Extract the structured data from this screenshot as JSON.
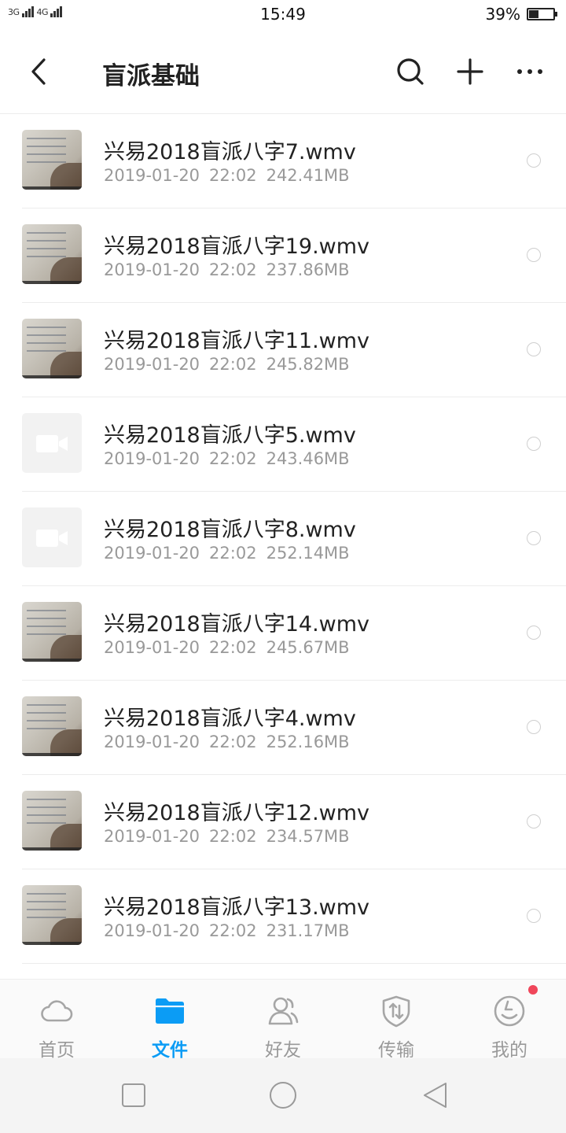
{
  "status_bar": {
    "network_1": "3G",
    "network_2": "4G",
    "time": "15:49",
    "battery_percent": "39%",
    "battery_level": 0.39
  },
  "header": {
    "title": "盲派基础",
    "icons": [
      "back-arrow-icon",
      "search-icon",
      "plus-icon",
      "more-icon"
    ]
  },
  "files": [
    {
      "name": "兴易2018盲派八字7.wmv",
      "date": "2019-01-20",
      "time": "22:02",
      "size": "242.41MB",
      "thumb": "photo"
    },
    {
      "name": "兴易2018盲派八字19.wmv",
      "date": "2019-01-20",
      "time": "22:02",
      "size": "237.86MB",
      "thumb": "photo"
    },
    {
      "name": "兴易2018盲派八字11.wmv",
      "date": "2019-01-20",
      "time": "22:02",
      "size": "245.82MB",
      "thumb": "photo"
    },
    {
      "name": "兴易2018盲派八字5.wmv",
      "date": "2019-01-20",
      "time": "22:02",
      "size": "243.46MB",
      "thumb": "video-placeholder"
    },
    {
      "name": "兴易2018盲派八字8.wmv",
      "date": "2019-01-20",
      "time": "22:02",
      "size": "252.14MB",
      "thumb": "video-placeholder"
    },
    {
      "name": "兴易2018盲派八字14.wmv",
      "date": "2019-01-20",
      "time": "22:02",
      "size": "245.67MB",
      "thumb": "photo"
    },
    {
      "name": "兴易2018盲派八字4.wmv",
      "date": "2019-01-20",
      "time": "22:02",
      "size": "252.16MB",
      "thumb": "photo"
    },
    {
      "name": "兴易2018盲派八字12.wmv",
      "date": "2019-01-20",
      "time": "22:02",
      "size": "234.57MB",
      "thumb": "photo"
    },
    {
      "name": "兴易2018盲派八字13.wmv",
      "date": "2019-01-20",
      "time": "22:02",
      "size": "231.17MB",
      "thumb": "photo"
    }
  ],
  "bottom_nav": {
    "items": [
      {
        "label": "首页",
        "icon": "cloud-icon",
        "active": false
      },
      {
        "label": "文件",
        "icon": "folder-icon",
        "active": true
      },
      {
        "label": "好友",
        "icon": "friends-icon",
        "active": false
      },
      {
        "label": "传输",
        "icon": "transfer-icon",
        "active": false
      },
      {
        "label": "我的",
        "icon": "profile-icon",
        "active": false,
        "badge": true
      }
    ]
  },
  "colors": {
    "accent": "#0b9cf5",
    "inactive": "#999999",
    "badge": "#f0465a"
  },
  "system_nav": [
    "recent-apps-icon",
    "home-icon",
    "back-triangle-icon"
  ]
}
